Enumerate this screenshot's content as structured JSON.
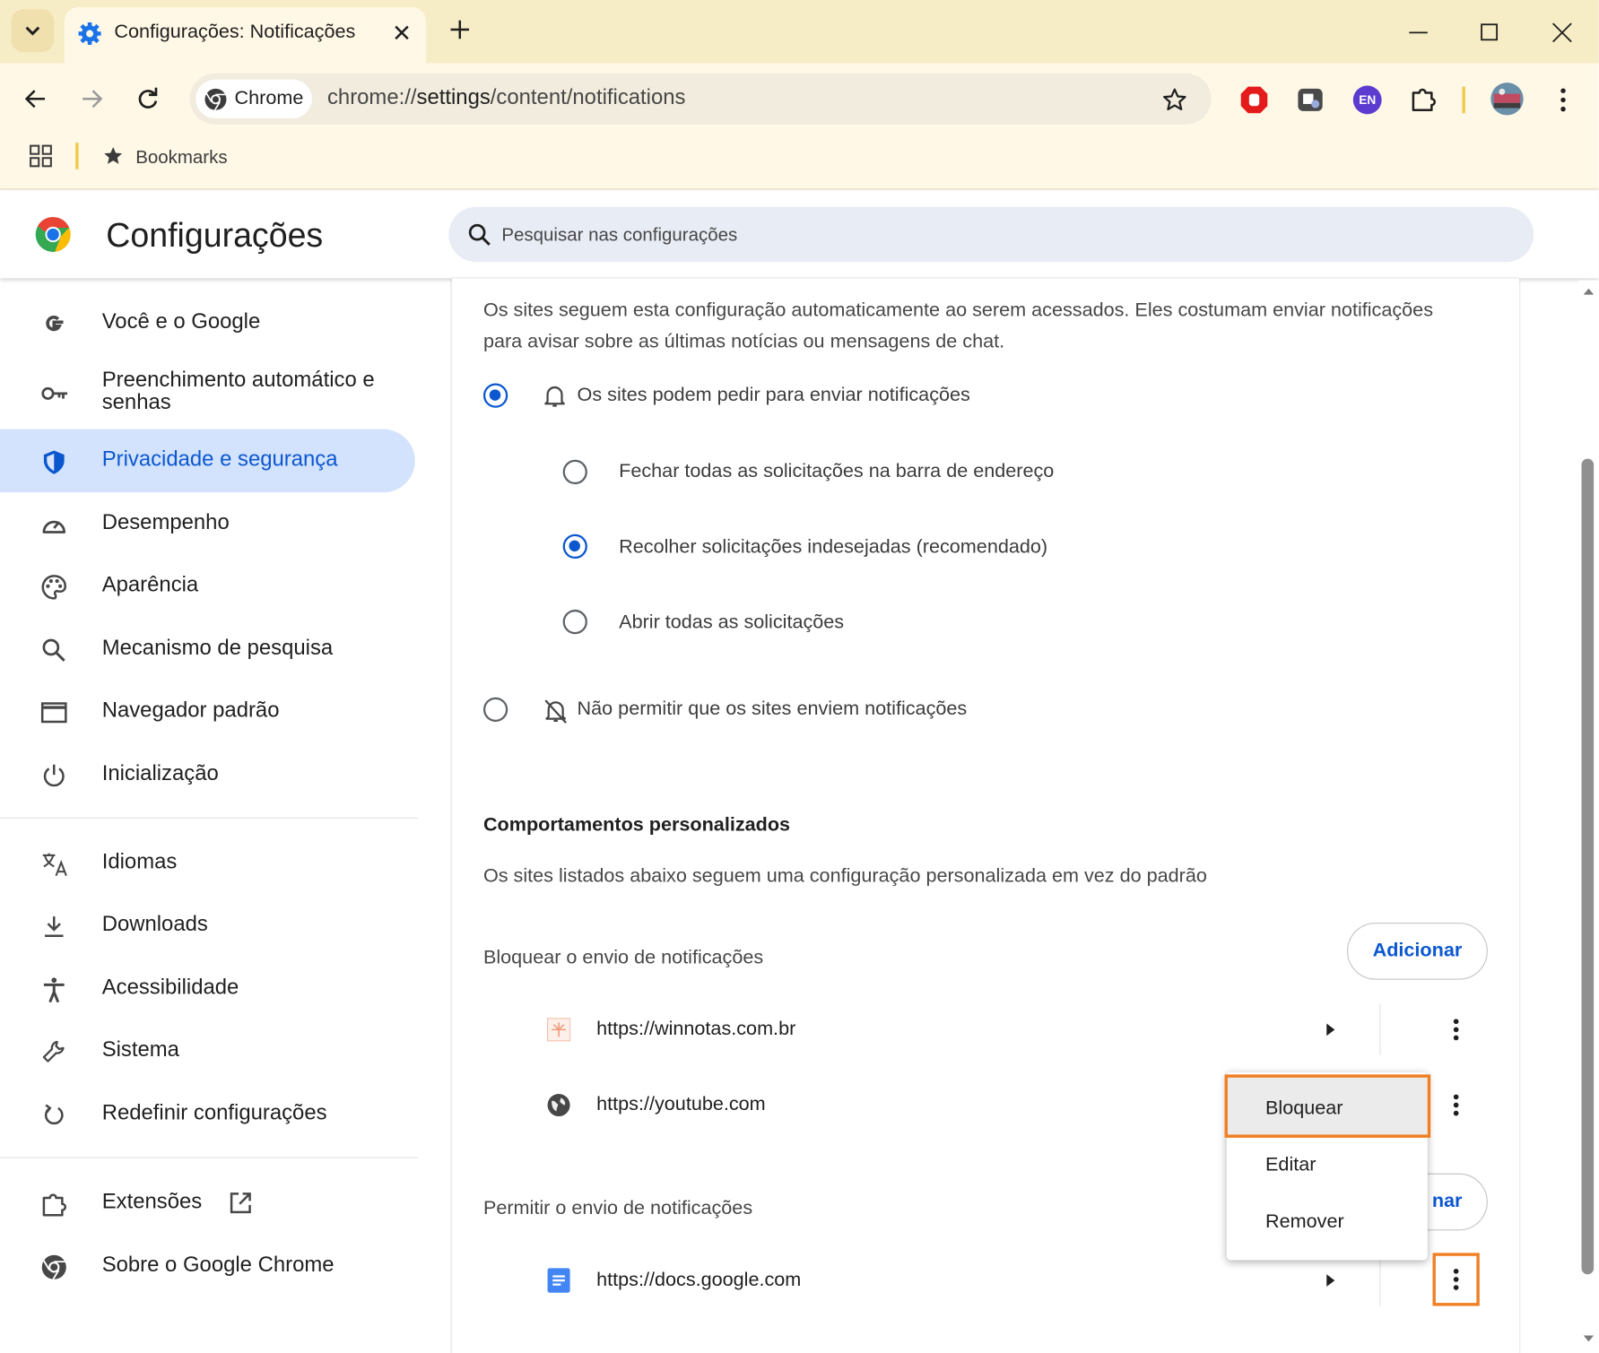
{
  "browser": {
    "tab": {
      "title": "Configurações: Notificações"
    },
    "chip_label": "Chrome",
    "url_prefix": "chrome://",
    "url_main": "settings",
    "url_suffix": "/content/notifications",
    "extension_en_label": "EN",
    "bookmarks_label": "Bookmarks",
    "accent": "#0b57d0",
    "frame_color": "#f6ecc5"
  },
  "settings": {
    "title": "Configurações",
    "search_placeholder": "Pesquisar nas configurações"
  },
  "sidebar": {
    "items": [
      {
        "label": "Você e o Google",
        "icon": "google-icon"
      },
      {
        "label": "Preenchimento automático e senhas",
        "icon": "key-icon"
      },
      {
        "label": "Privacidade e segurança",
        "icon": "shield-icon",
        "active": true
      },
      {
        "label": "Desempenho",
        "icon": "speedometer-icon"
      },
      {
        "label": "Aparência",
        "icon": "palette-icon"
      },
      {
        "label": "Mecanismo de pesquisa",
        "icon": "search-icon"
      },
      {
        "label": "Navegador padrão",
        "icon": "browser-window-icon"
      },
      {
        "label": "Inicialização",
        "icon": "power-icon"
      },
      {
        "label": "Idiomas",
        "icon": "translate-icon"
      },
      {
        "label": "Downloads",
        "icon": "download-icon"
      },
      {
        "label": "Acessibilidade",
        "icon": "accessibility-icon"
      },
      {
        "label": "Sistema",
        "icon": "wrench-icon"
      },
      {
        "label": "Redefinir configurações",
        "icon": "reset-icon"
      },
      {
        "label": "Extensões",
        "icon": "puzzle-icon"
      },
      {
        "label": "Sobre o Google Chrome",
        "icon": "chrome-icon"
      }
    ]
  },
  "content": {
    "intro_line1": "Os sites seguem esta configuração automaticamente ao serem acessados. Eles costumam enviar notificações",
    "intro_line2": "para avisar sobre as últimas notícias ou mensagens de chat.",
    "option_allow_ask": "Os sites podem pedir para enviar notificações",
    "sub_option_close": "Fechar todas as solicitações na barra de endereço",
    "sub_option_collapse": "Recolher solicitações indesejadas (recomendado)",
    "sub_option_open": "Abrir todas as solicitações",
    "option_block": "Não permitir que os sites enviem notificações",
    "selected_option": "Os sites podem pedir para enviar notificações",
    "selected_sub_option": "Recolher solicitações indesejadas (recomendado)",
    "custom_heading": "Comportamentos personalizados",
    "custom_desc": "Os sites listados abaixo seguem uma configuração personalizada em vez do padrão",
    "block_section_title": "Bloquear o envio de notificações",
    "add_label": "Adicionar",
    "block_sites": [
      "https://winnotas.com.br",
      "https://youtube.com"
    ],
    "allow_section_title": "Permitir o envio de notificações",
    "add_label_partial": "nar",
    "allow_sites": [
      "https://docs.google.com"
    ]
  },
  "menu": {
    "items": [
      "Bloquear",
      "Editar",
      "Remover"
    ],
    "highlighted": "Bloquear",
    "highlight_color": "#f07f23"
  }
}
